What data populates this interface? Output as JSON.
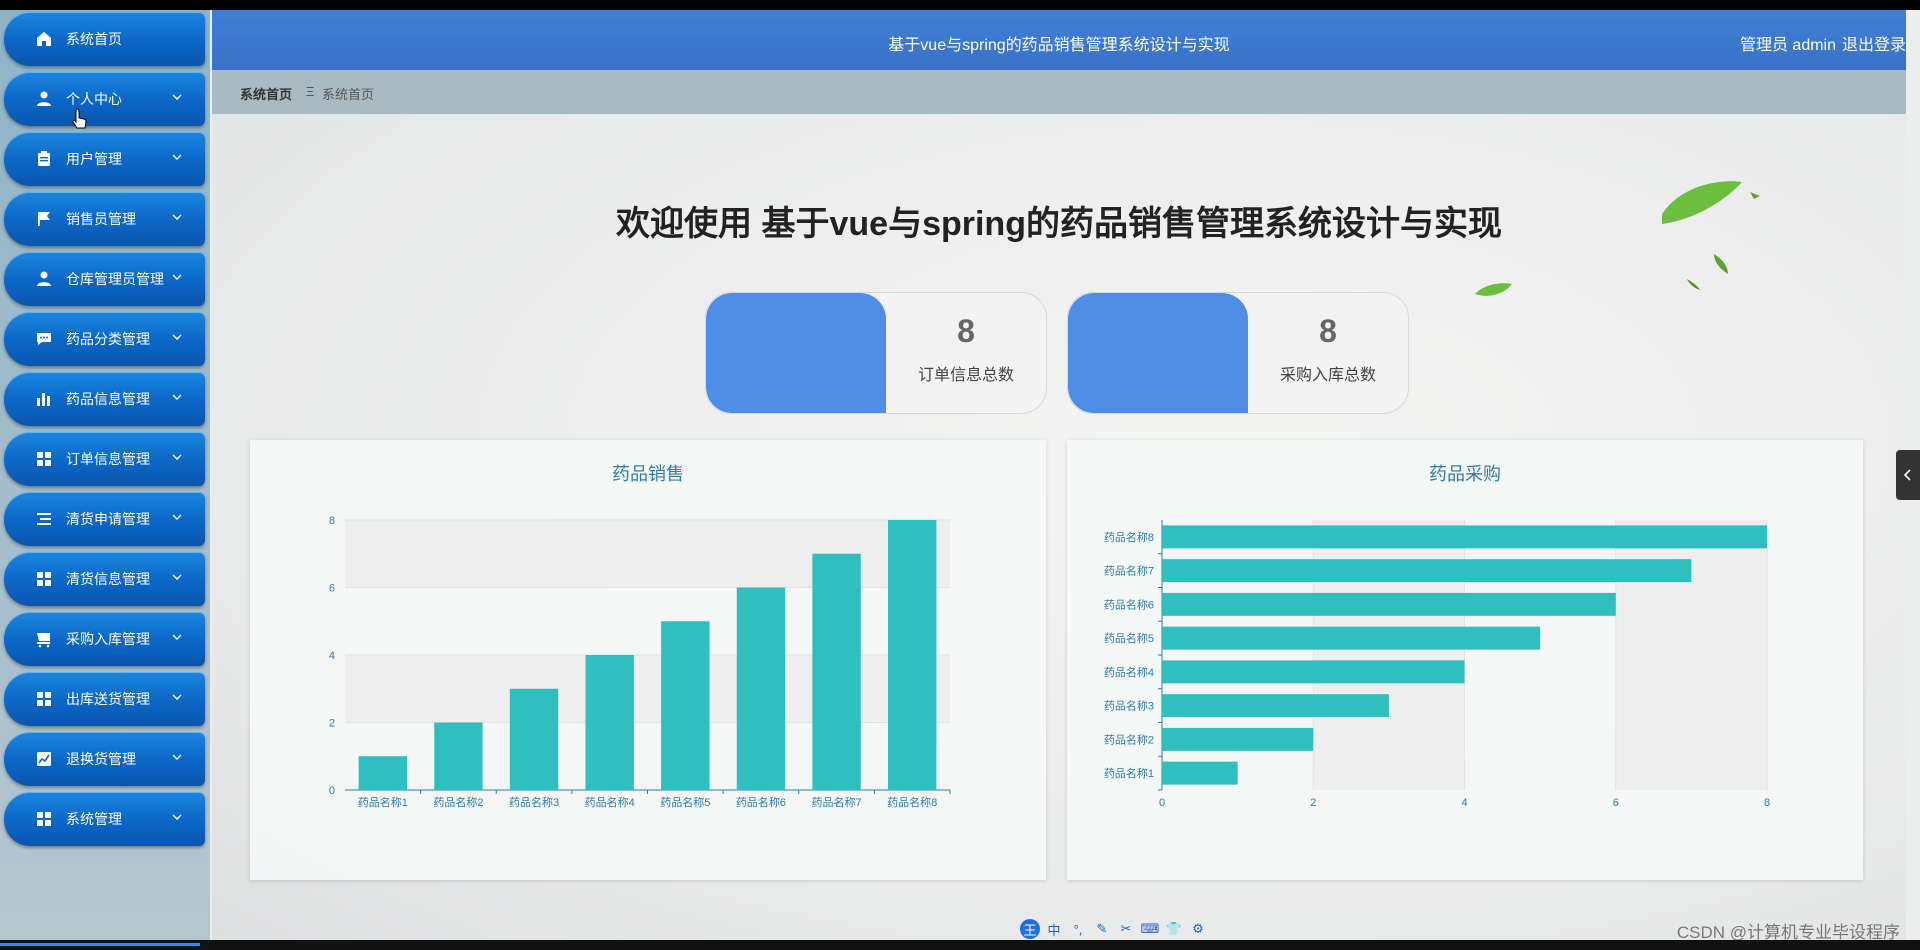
{
  "header": {
    "title": "基于vue与spring的药品销售管理系统设计与实现",
    "user": "管理员 admin",
    "logout": "退出登录"
  },
  "breadcrumb": {
    "home": "系统首页",
    "separator": "Ξ",
    "current": "系统首页"
  },
  "sidebar": {
    "items": [
      {
        "label": "系统首页",
        "icon": "home-icon"
      },
      {
        "label": "个人中心",
        "icon": "user-icon"
      },
      {
        "label": "用户管理",
        "icon": "clipboard-icon"
      },
      {
        "label": "销售员管理",
        "icon": "flag-icon"
      },
      {
        "label": "仓库管理员管理",
        "icon": "user-icon"
      },
      {
        "label": "药品分类管理",
        "icon": "message-icon"
      },
      {
        "label": "药品信息管理",
        "icon": "bar-chart-icon"
      },
      {
        "label": "订单信息管理",
        "icon": "grid-icon"
      },
      {
        "label": "清货申请管理",
        "icon": "list-icon"
      },
      {
        "label": "清货信息管理",
        "icon": "grid-icon"
      },
      {
        "label": "采购入库管理",
        "icon": "cart-icon"
      },
      {
        "label": "出库送货管理",
        "icon": "grid-icon"
      },
      {
        "label": "退换货管理",
        "icon": "line-chart-icon"
      },
      {
        "label": "系统管理",
        "icon": "grid-icon"
      }
    ]
  },
  "welcome": "欢迎使用 基于vue与spring的药品销售管理系统设计与实现",
  "stats": [
    {
      "value": "8",
      "label": "订单信息总数"
    },
    {
      "value": "8",
      "label": "采购入库总数"
    }
  ],
  "colors": {
    "accent": "#4f8ee6",
    "bar": "#2fbfbf",
    "header": "#3f7fd6",
    "menu": "#0b66c6"
  },
  "chart_data": [
    {
      "type": "bar",
      "title": "药品销售",
      "categories": [
        "药品名称1",
        "药品名称2",
        "药品名称3",
        "药品名称4",
        "药品名称5",
        "药品名称6",
        "药品名称7",
        "药品名称8"
      ],
      "values": [
        1,
        2,
        3,
        4,
        5,
        6,
        7,
        8
      ],
      "ylim": [
        0,
        8
      ],
      "yticks": [
        "0",
        "2",
        "4",
        "6",
        "8"
      ],
      "orientation": "vertical"
    },
    {
      "type": "bar",
      "title": "药品采购",
      "categories": [
        "药品名称1",
        "药品名称2",
        "药品名称3",
        "药品名称4",
        "药品名称5",
        "药品名称6",
        "药品名称7",
        "药品名称8"
      ],
      "values": [
        1,
        2,
        3,
        4,
        5,
        6,
        7,
        8
      ],
      "xlim": [
        0,
        8
      ],
      "xticks": [
        "0",
        "2",
        "4",
        "6",
        "8"
      ],
      "orientation": "horizontal"
    }
  ],
  "watermark": "CSDN @计算机专业毕设程序",
  "ime": [
    "王",
    "中",
    "°,",
    "✎",
    "✂",
    "⌨",
    "👕",
    "⚙"
  ]
}
